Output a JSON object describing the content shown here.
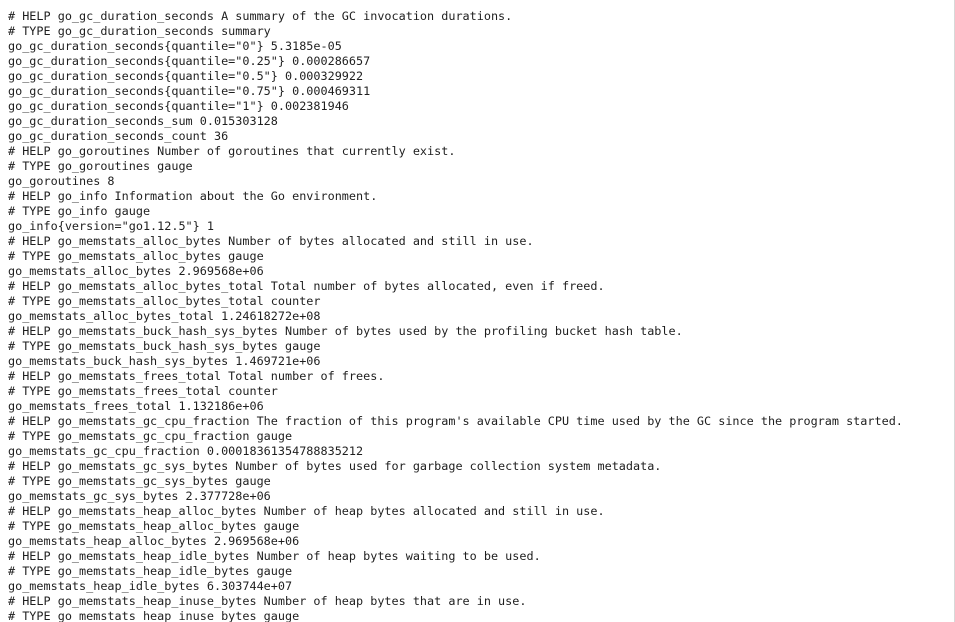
{
  "lines": [
    "# HELP go_gc_duration_seconds A summary of the GC invocation durations.",
    "# TYPE go_gc_duration_seconds summary",
    "go_gc_duration_seconds{quantile=\"0\"} 5.3185e-05",
    "go_gc_duration_seconds{quantile=\"0.25\"} 0.000286657",
    "go_gc_duration_seconds{quantile=\"0.5\"} 0.000329922",
    "go_gc_duration_seconds{quantile=\"0.75\"} 0.000469311",
    "go_gc_duration_seconds{quantile=\"1\"} 0.002381946",
    "go_gc_duration_seconds_sum 0.015303128",
    "go_gc_duration_seconds_count 36",
    "# HELP go_goroutines Number of goroutines that currently exist.",
    "# TYPE go_goroutines gauge",
    "go_goroutines 8",
    "# HELP go_info Information about the Go environment.",
    "# TYPE go_info gauge",
    "go_info{version=\"go1.12.5\"} 1",
    "# HELP go_memstats_alloc_bytes Number of bytes allocated and still in use.",
    "# TYPE go_memstats_alloc_bytes gauge",
    "go_memstats_alloc_bytes 2.969568e+06",
    "# HELP go_memstats_alloc_bytes_total Total number of bytes allocated, even if freed.",
    "# TYPE go_memstats_alloc_bytes_total counter",
    "go_memstats_alloc_bytes_total 1.24618272e+08",
    "# HELP go_memstats_buck_hash_sys_bytes Number of bytes used by the profiling bucket hash table.",
    "# TYPE go_memstats_buck_hash_sys_bytes gauge",
    "go_memstats_buck_hash_sys_bytes 1.469721e+06",
    "# HELP go_memstats_frees_total Total number of frees.",
    "# TYPE go_memstats_frees_total counter",
    "go_memstats_frees_total 1.132186e+06",
    "# HELP go_memstats_gc_cpu_fraction The fraction of this program's available CPU time used by the GC since the program started.",
    "# TYPE go_memstats_gc_cpu_fraction gauge",
    "go_memstats_gc_cpu_fraction 0.00018361354788835212",
    "# HELP go_memstats_gc_sys_bytes Number of bytes used for garbage collection system metadata.",
    "# TYPE go_memstats_gc_sys_bytes gauge",
    "go_memstats_gc_sys_bytes 2.377728e+06",
    "# HELP go_memstats_heap_alloc_bytes Number of heap bytes allocated and still in use.",
    "# TYPE go_memstats_heap_alloc_bytes gauge",
    "go_memstats_heap_alloc_bytes 2.969568e+06",
    "# HELP go_memstats_heap_idle_bytes Number of heap bytes waiting to be used.",
    "# TYPE go_memstats_heap_idle_bytes gauge",
    "go_memstats_heap_idle_bytes 6.303744e+07",
    "# HELP go_memstats_heap_inuse_bytes Number of heap bytes that are in use.",
    "# TYPE go_memstats_heap_inuse_bytes gauge"
  ]
}
